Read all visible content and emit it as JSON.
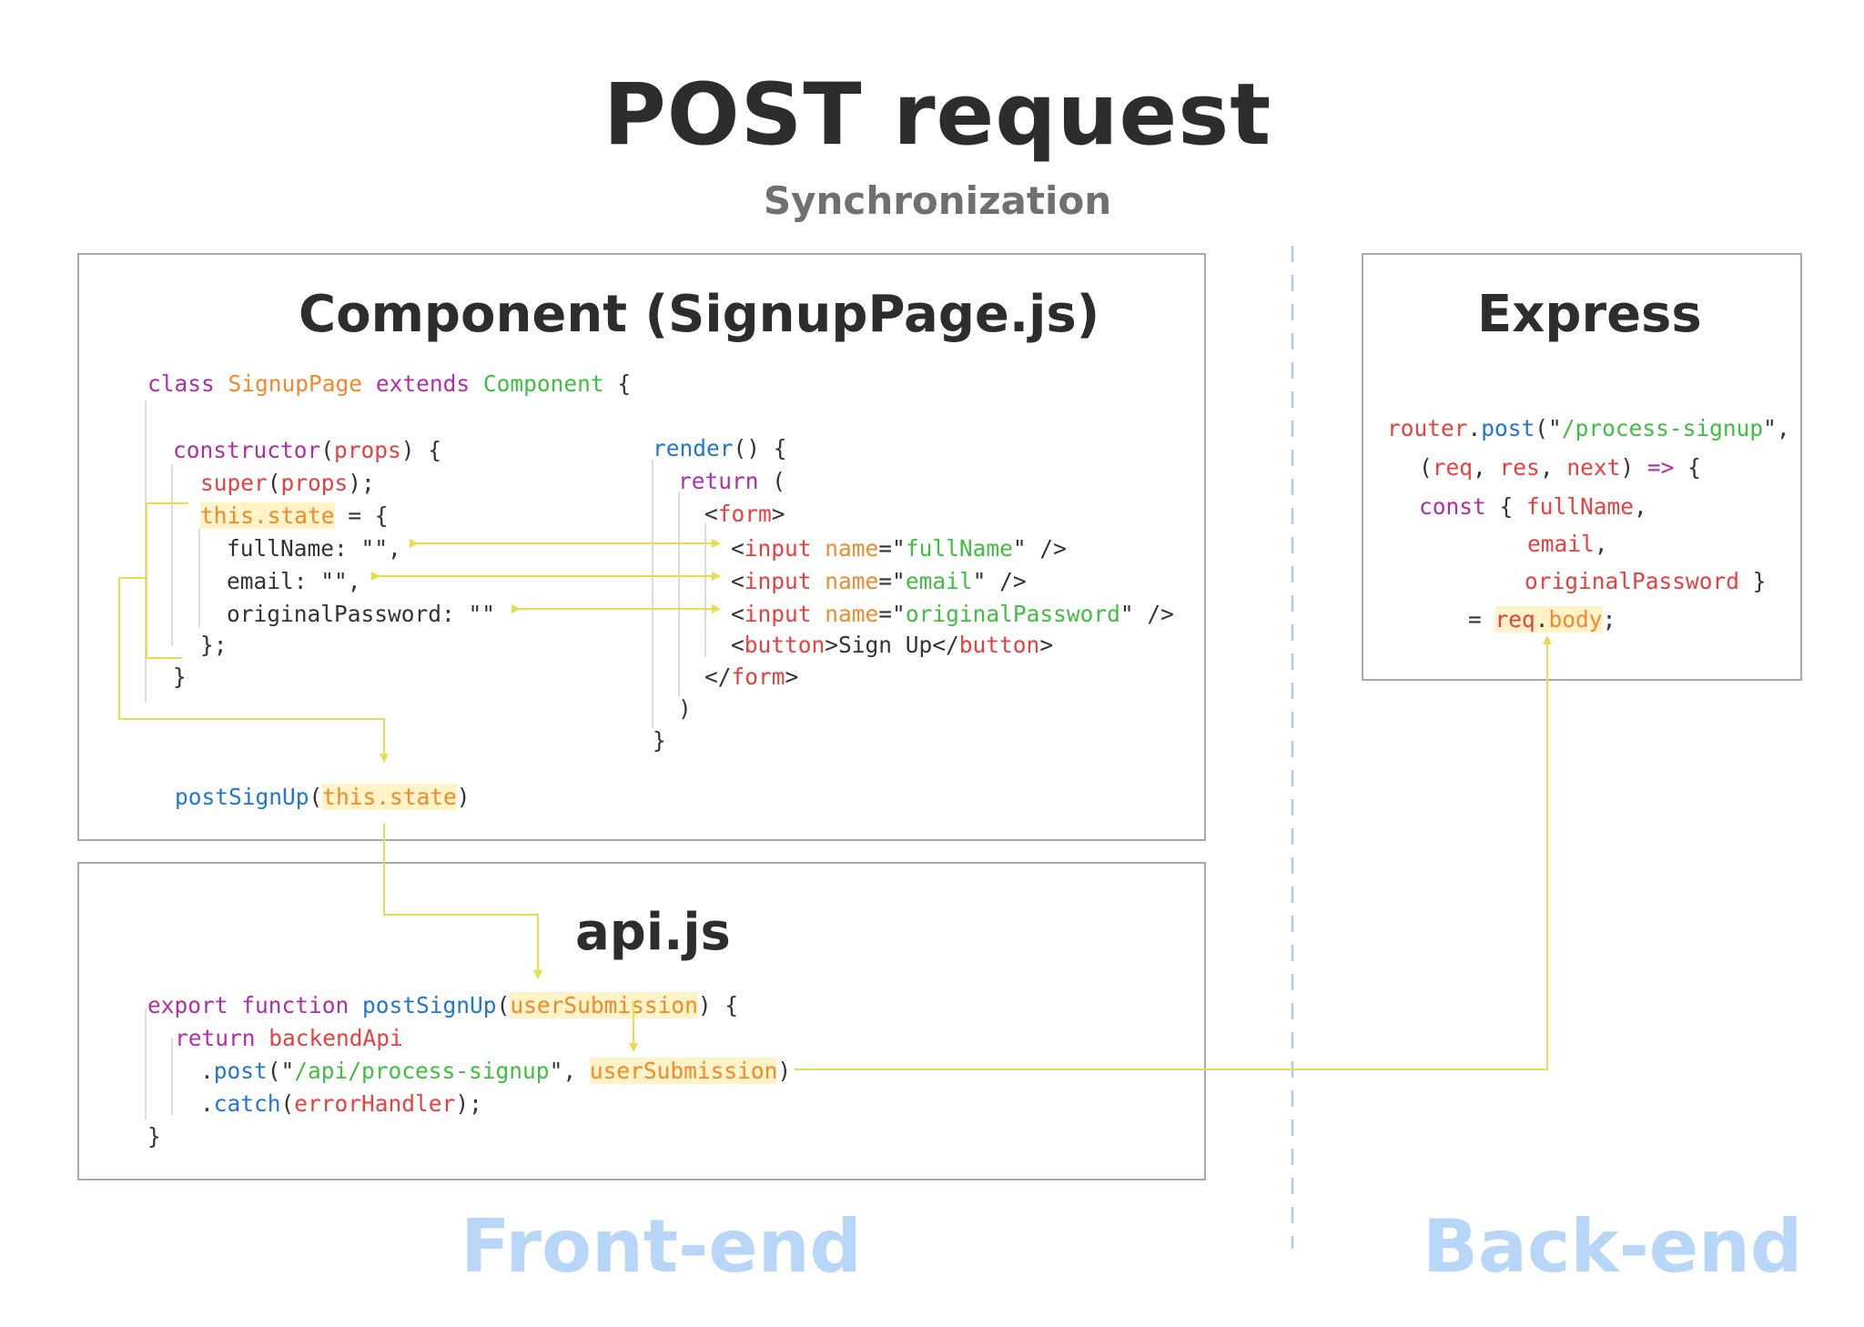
{
  "header": {
    "title": "POST request",
    "subtitle": "Synchronization"
  },
  "component_panel": {
    "title": "Component (SignupPage.js)",
    "class_line": {
      "kw_class": "class",
      "class_name": "SignupPage",
      "kw_extends": "extends",
      "base": "Component",
      "brace": "{"
    },
    "constructor_line": {
      "name": "constructor",
      "paren_open": "(",
      "param": "props",
      "rest": ") {"
    },
    "super_line": {
      "name": "super",
      "paren_open": "(",
      "arg": "props",
      "rest": ");"
    },
    "state_line": {
      "target": "this.state",
      "rest": " = {"
    },
    "state_fields": [
      {
        "text": "fullName: \"\","
      },
      {
        "text": "email: \"\","
      },
      {
        "text": "originalPassword: \"\""
      }
    ],
    "state_close": "};",
    "constructor_close": "}",
    "render_line": {
      "name": "render",
      "rest": "() {"
    },
    "return_line": {
      "kw": "return",
      "rest": " ("
    },
    "form_open": {
      "lt": "<",
      "tag": "form",
      "gt": ">"
    },
    "inputs": [
      {
        "lt": "<",
        "tag": "input",
        "attr": " name",
        "eq": "=\"",
        "value": "fullName",
        "close": "\" />"
      },
      {
        "lt": "<",
        "tag": "input",
        "attr": " name",
        "eq": "=\"",
        "value": "email",
        "close": "\" />"
      },
      {
        "lt": "<",
        "tag": "input",
        "attr": " name",
        "eq": "=\"",
        "value": "originalPassword",
        "close": "\" />"
      }
    ],
    "button_line": {
      "lt": "<",
      "tag": "button",
      "text": ">Sign Up</",
      "tag2": "button",
      "gt": ">"
    },
    "form_close": {
      "lt": "</",
      "tag": "form",
      "gt": ">"
    },
    "paren_close": ")",
    "render_close": "}",
    "call_line": {
      "name": "postSignUp",
      "paren_open": "(",
      "arg": "this.state",
      "paren_close": ")"
    }
  },
  "api_panel": {
    "title": "api.js",
    "export_line": {
      "kw": "export function",
      "name": "postSignUp",
      "paren_open": "(",
      "param": "userSubmission",
      "rest": ") {"
    },
    "return_line": {
      "kw": "return",
      "obj": "backendApi"
    },
    "post_line": {
      "dot": ".",
      "method": "post",
      "paren_open": "(\"",
      "url": "/api/process-signup",
      "sep": "\", ",
      "arg": "userSubmission",
      "paren_close": ")"
    },
    "catch_line": {
      "dot": ".",
      "method": "catch",
      "paren_open": "(",
      "arg": "errorHandler",
      "rest": ");"
    },
    "close": "}"
  },
  "express_panel": {
    "title": "Express",
    "router_line": {
      "obj": "router",
      "dot": ".",
      "method": "post",
      "paren_open": "(\"",
      "url": "/process-signup",
      "rest": "\","
    },
    "params_line": {
      "open": "(",
      "p1": "req",
      "sep1": ", ",
      "p2": "res",
      "sep2": ", ",
      "p3": "next",
      "close": ")",
      "arrow": " =>",
      "brace": " {"
    },
    "const_line": {
      "kw": "const",
      "brace": " { ",
      "field": "fullName",
      "comma": ","
    },
    "email_line": {
      "field": "email",
      "comma": ","
    },
    "password_line": {
      "field": "originalPassword",
      "close": " }"
    },
    "assign_line": {
      "eq": "= ",
      "obj": "req",
      "dot": ".",
      "prop": "body",
      "end": ";"
    }
  },
  "regions": {
    "frontend": "Front-end",
    "backend": "Back-end"
  },
  "colors": {
    "keyword": "#b02fa8",
    "class_name": "#f08a2c",
    "string": "#3fbf3f",
    "identifier": "#e84040",
    "function": "#2275d0",
    "highlight": "#fff3c8",
    "arrow": "#e8dc50",
    "region_label": "#b8d6f7",
    "divider": "#a8cdf0"
  }
}
